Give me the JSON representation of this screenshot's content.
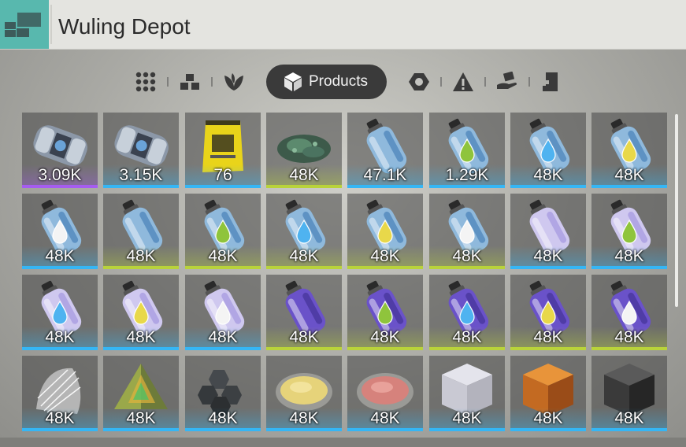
{
  "header": {
    "title": "Wuling Depot",
    "small_logo_text": "",
    "accent_color": "#58b8ae"
  },
  "filter_bar": {
    "active_label": "Products",
    "icons": [
      "all-grid-icon",
      "blocks-icon",
      "plant-icon",
      "products-icon",
      "ore-icon",
      "warning-icon",
      "hand-delivery-icon",
      "building-icon"
    ]
  },
  "rarity_colors": {
    "purple": "#a65cf0",
    "blue": "#35b6f5",
    "green": "#b9d33a"
  },
  "inventory": {
    "items": [
      {
        "count": "3.09K",
        "rarity": "purple",
        "icon": "capsule-icon"
      },
      {
        "count": "3.15K",
        "rarity": "blue",
        "icon": "capsule-icon"
      },
      {
        "count": "76",
        "rarity": "blue",
        "icon": "yellow-bag-icon"
      },
      {
        "count": "48K",
        "rarity": "green",
        "icon": "moss-icon"
      },
      {
        "count": "47.1K",
        "rarity": "blue",
        "icon": "bottle-icon"
      },
      {
        "count": "1.29K",
        "rarity": "blue",
        "icon": "bottle-green-drop-icon"
      },
      {
        "count": "48K",
        "rarity": "blue",
        "icon": "bottle-blue-drop-icon"
      },
      {
        "count": "48K",
        "rarity": "blue",
        "icon": "bottle-yellow-drop-icon"
      },
      {
        "count": "48K",
        "rarity": "blue",
        "icon": "bottle-white-drop-icon"
      },
      {
        "count": "48K",
        "rarity": "green",
        "icon": "bottle-icon"
      },
      {
        "count": "48K",
        "rarity": "green",
        "icon": "bottle-green-drop-icon"
      },
      {
        "count": "48K",
        "rarity": "green",
        "icon": "bottle-blue-drop-icon"
      },
      {
        "count": "48K",
        "rarity": "green",
        "icon": "bottle-yellow-drop-icon"
      },
      {
        "count": "48K",
        "rarity": "green",
        "icon": "bottle-white-drop-icon"
      },
      {
        "count": "48K",
        "rarity": "blue",
        "icon": "lavender-bottle-icon"
      },
      {
        "count": "48K",
        "rarity": "blue",
        "icon": "lavender-bottle-green-drop-icon"
      },
      {
        "count": "48K",
        "rarity": "blue",
        "icon": "lavender-bottle-blue-drop-icon"
      },
      {
        "count": "48K",
        "rarity": "blue",
        "icon": "lavender-bottle-yellow-drop-icon"
      },
      {
        "count": "48K",
        "rarity": "blue",
        "icon": "lavender-bottle-white-drop-icon"
      },
      {
        "count": "48K",
        "rarity": "green",
        "icon": "purple-bottle-icon"
      },
      {
        "count": "48K",
        "rarity": "green",
        "icon": "purple-bottle-green-drop-icon"
      },
      {
        "count": "48K",
        "rarity": "green",
        "icon": "purple-bottle-blue-drop-icon"
      },
      {
        "count": "48K",
        "rarity": "green",
        "icon": "purple-bottle-yellow-drop-icon"
      },
      {
        "count": "48K",
        "rarity": "green",
        "icon": "purple-bottle-white-drop-icon"
      },
      {
        "count": "48K",
        "rarity": "blue",
        "icon": "mesh-icon"
      },
      {
        "count": "48K",
        "rarity": "blue",
        "icon": "pyramid-icon"
      },
      {
        "count": "48K",
        "rarity": "blue",
        "icon": "hex-blocks-icon"
      },
      {
        "count": "48K",
        "rarity": "blue",
        "icon": "yellow-powder-bowl-icon"
      },
      {
        "count": "48K",
        "rarity": "blue",
        "icon": "red-powder-bowl-icon"
      },
      {
        "count": "48K",
        "rarity": "blue",
        "icon": "white-cube-icon"
      },
      {
        "count": "48K",
        "rarity": "blue",
        "icon": "orange-cube-icon"
      },
      {
        "count": "48K",
        "rarity": "blue",
        "icon": "black-cube-icon"
      }
    ]
  }
}
